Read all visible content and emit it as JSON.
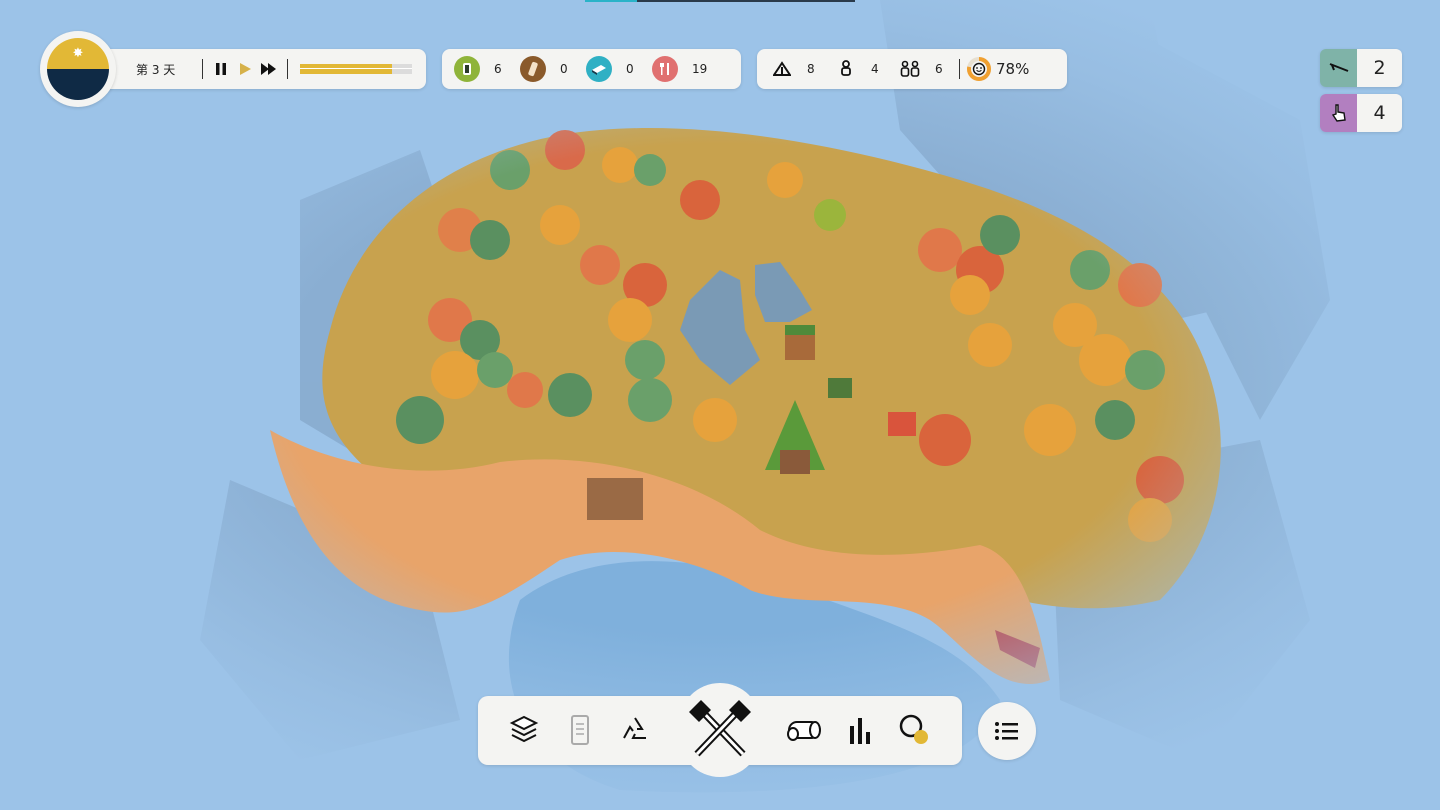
{
  "hud": {
    "day_label": "第 3 天",
    "day_progress_pct": 82,
    "colors": {
      "day": "#e2b836",
      "night": "#0f2a45",
      "progress": "#e2b836"
    }
  },
  "resources": [
    {
      "icon": "seed-icon",
      "value": "6",
      "color": "#8fb43a"
    },
    {
      "icon": "wood-log-icon",
      "value": "0",
      "color": "#8a5a2b"
    },
    {
      "icon": "stone-icon",
      "value": "0",
      "color": "#2fb0c4"
    },
    {
      "icon": "food-icon",
      "value": "19",
      "color": "#e07070"
    }
  ],
  "population": {
    "tents": "8",
    "adults": "4",
    "families": "6",
    "happiness": "78%",
    "happiness_pct": 78
  },
  "counters": [
    {
      "icon": "rifle-icon",
      "value": "2",
      "color": "#7fb3a8"
    },
    {
      "icon": "pointing-hand-icon",
      "value": "4",
      "color": "#b27fc0"
    }
  ],
  "toolbar": {
    "tools": [
      "layers-icon",
      "scroll-icon",
      "recycle-icon",
      "build-hammers-icon",
      "logs-icon",
      "bar-chart-icon",
      "search-icon"
    ],
    "menu": "list-menu-icon"
  }
}
